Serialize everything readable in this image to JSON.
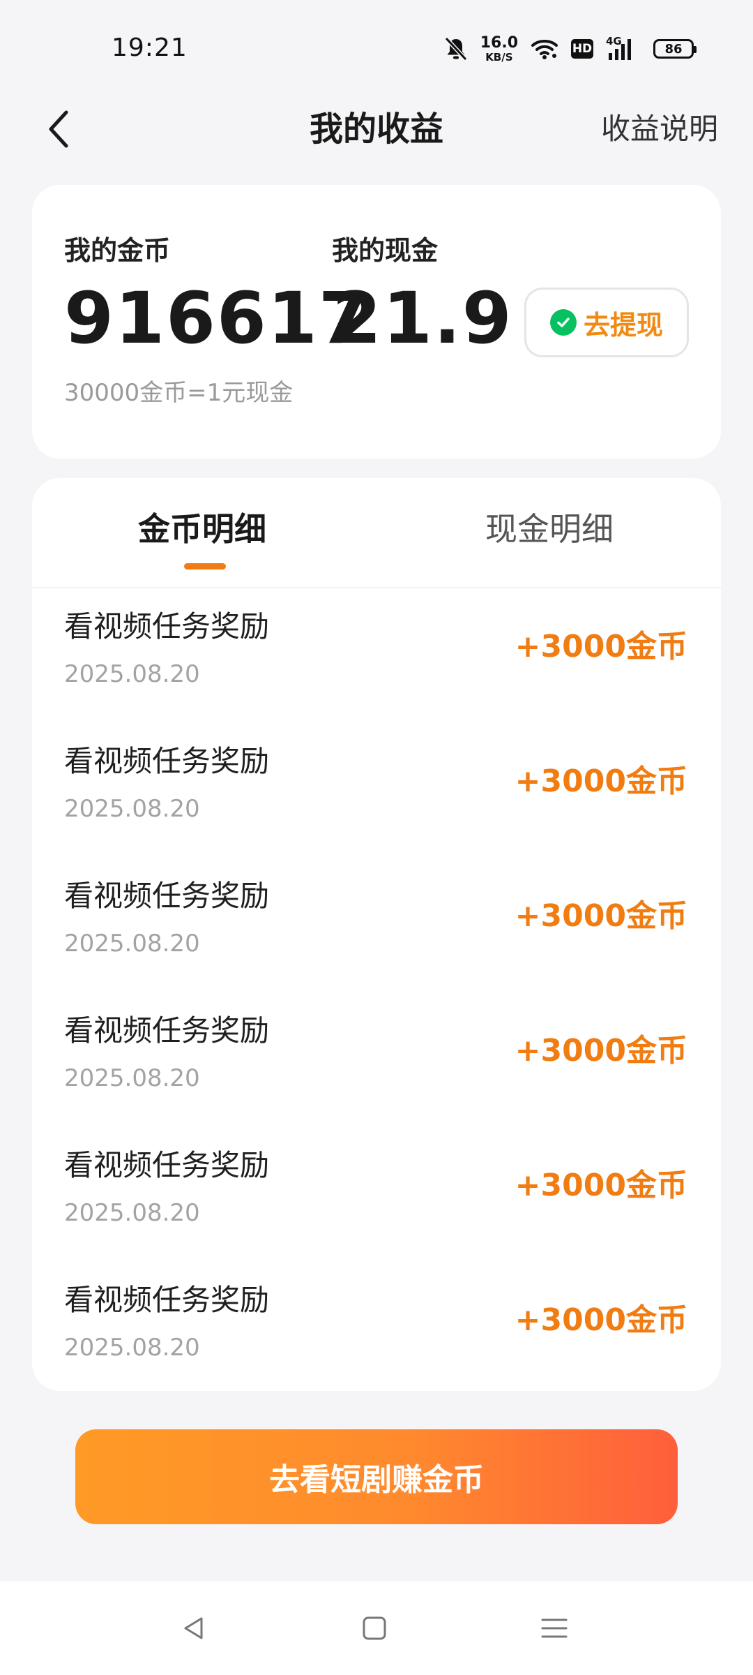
{
  "status_bar": {
    "time": "19:21",
    "net_speed_value": "16.0",
    "net_speed_unit": "KB/S",
    "hd_label": "HD",
    "network_gen": "4G",
    "battery": "86",
    "icons": [
      "mute-bell-icon",
      "wifi-icon",
      "signal-icon",
      "battery-icon"
    ]
  },
  "header": {
    "title": "我的收益",
    "right_link": "收益说明"
  },
  "wallet": {
    "coins_label": "我的金币",
    "coins_value": "916617",
    "cash_label": "我的现金",
    "cash_value": "21.9",
    "rate_note": "30000金币=1元现金",
    "withdraw_label": "去提现"
  },
  "tabs": {
    "coins": "金币明细",
    "cash": "现金明细",
    "active": "coins"
  },
  "records": [
    {
      "title": "看视频任务奖励",
      "date": "2025.08.20",
      "amount": "+3000金币"
    },
    {
      "title": "看视频任务奖励",
      "date": "2025.08.20",
      "amount": "+3000金币"
    },
    {
      "title": "看视频任务奖励",
      "date": "2025.08.20",
      "amount": "+3000金币"
    },
    {
      "title": "看视频任务奖励",
      "date": "2025.08.20",
      "amount": "+3000金币"
    },
    {
      "title": "看视频任务奖励",
      "date": "2025.08.20",
      "amount": "+3000金币"
    },
    {
      "title": "看视频任务奖励",
      "date": "2025.08.20",
      "amount": "+3000金币"
    }
  ],
  "cta": {
    "label": "去看短剧赚金币"
  },
  "colors": {
    "accent": "#f07c12",
    "wechat_green": "#07c160",
    "background": "#f5f5f8"
  }
}
